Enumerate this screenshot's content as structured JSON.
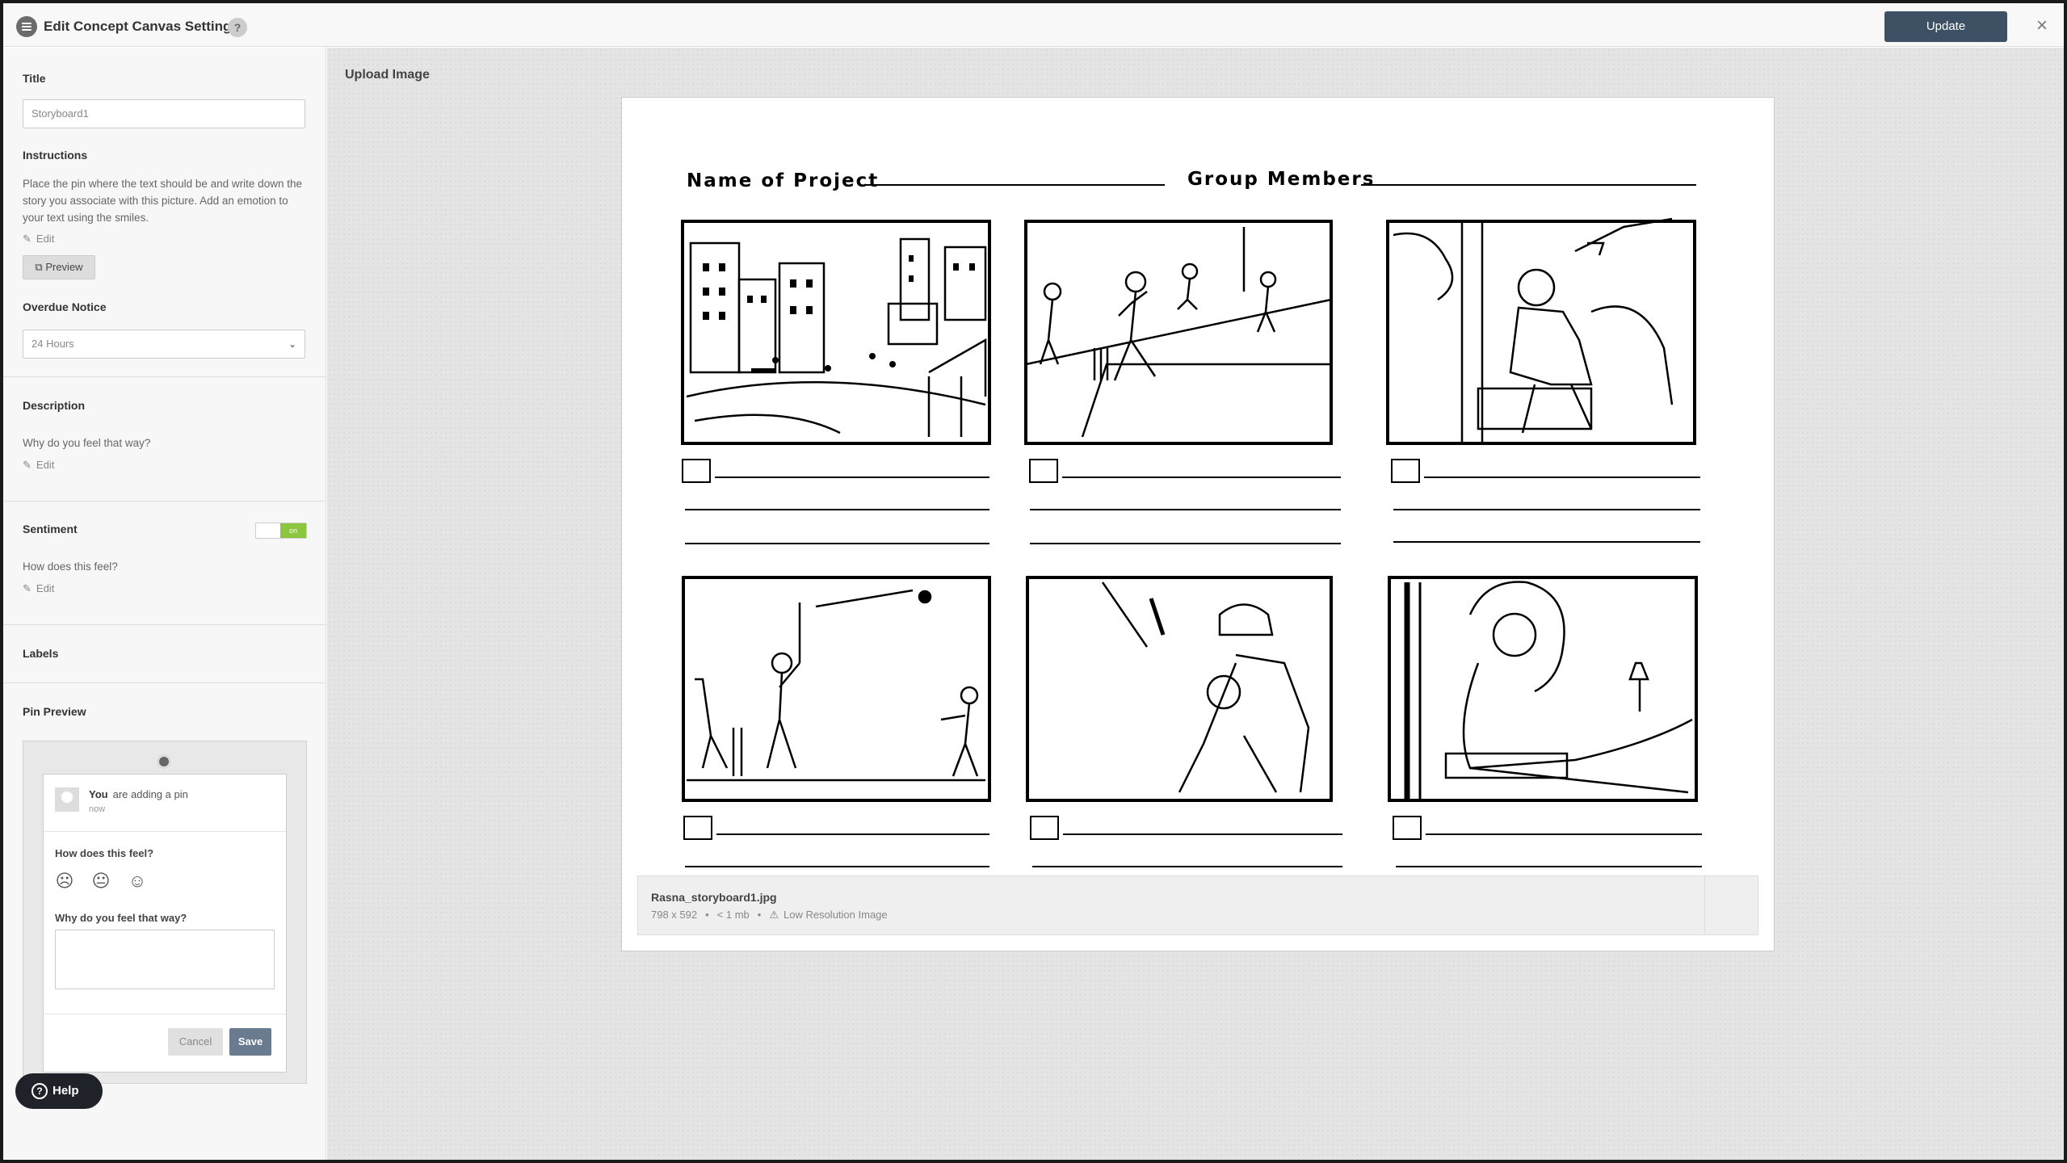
{
  "header": {
    "title": "Edit Concept Canvas Settings",
    "help_icon": "?",
    "update_label": "Update",
    "close_icon": "×"
  },
  "sidebar": {
    "title_label": "Title",
    "title_value": "Storyboard1",
    "instructions_label": "Instructions",
    "instructions_text": "Place the pin where the text should be and write down the story you associate with this picture. Add an emotion to your text using the smiles.",
    "edit_label": "Edit",
    "preview_label": "Preview",
    "overdue_label": "Overdue Notice",
    "overdue_value": "24 Hours",
    "description_label": "Description",
    "description_text": "Why do you feel that way?",
    "sentiment_label": "Sentiment",
    "sentiment_toggle": "on",
    "sentiment_text": "How does this feel?",
    "labels_label": "Labels",
    "pin_preview_label": "Pin Preview"
  },
  "pin": {
    "user": "You",
    "action": "are adding a pin",
    "time": "now",
    "q1": "How does this feel?",
    "q2": "Why do you feel that way?",
    "faces": [
      "sad-face-icon",
      "neutral-face-icon",
      "happy-face-icon"
    ],
    "cancel_label": "Cancel",
    "save_label": "Save"
  },
  "help": {
    "label": "Help"
  },
  "main": {
    "upload_label": "Upload Image",
    "sheet": {
      "project_label": "Name of Project",
      "members_label": "Group Members"
    },
    "file": {
      "name": "Rasna_storyboard1.jpg",
      "dimensions": "798 x 592",
      "size": "< 1 mb",
      "warning": "Low Resolution Image"
    }
  }
}
